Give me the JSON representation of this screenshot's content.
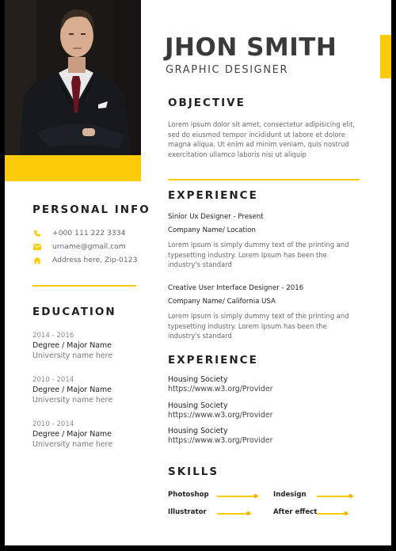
{
  "header": {
    "name": "JHON SMITH",
    "role": "GRAPHIC DESIGNER"
  },
  "colors": {
    "accent": "#fccc0b",
    "text": "#222222",
    "muted": "#6a6a6a"
  },
  "objective": {
    "heading": "OBJECTIVE",
    "lines": [
      "Lorem ipsum dolor sit amet, consectetur adipisicing elit,",
      "sed do eiusmod tempor incididunt ut labore et dolore",
      "magna aliqua. Ut enim ad minim veniam, quis nostrud",
      "exercitation ullamco laboris nisi ut aliquip"
    ]
  },
  "experience": {
    "heading": "EXPERIENCE",
    "items": [
      {
        "title": "Sinior Ux Designer - Present",
        "company": "Company Name/ Location",
        "lines": [
          "Lorem Ipsum is simply dummy text of the printing and",
          "typesetting industry. Lorem Ipsum has been the",
          "industry's standard"
        ]
      },
      {
        "title": "Creative User Interface Designer - 2016",
        "company": "Company Name/ California USA",
        "lines": [
          "Lorem Ipsum is simply dummy text of the printing and",
          "typesetting industry. Lorem Ipsum has been the",
          "industry's standard"
        ]
      }
    ]
  },
  "projects": {
    "heading": "EXPERIENCE",
    "items": [
      {
        "title": "Housing Society",
        "url": "https://www.w3.org/Provider"
      },
      {
        "title": "Housing Society",
        "url": "https://www.w3.org/Provider"
      },
      {
        "title": "Housing Society",
        "url": "https://www.w3.org/Provider"
      }
    ]
  },
  "skills": {
    "heading": "SKILLS",
    "items": [
      {
        "name": "Photoshop",
        "level": 0.9
      },
      {
        "name": "Indesign",
        "level": 0.8
      },
      {
        "name": "Illustrator",
        "level": 0.75
      },
      {
        "name": "After effect",
        "level": 0.7
      }
    ]
  },
  "personal_info": {
    "heading": "PERSONAL INFO",
    "phone": "+000 111 222 3334",
    "email": "urname@gmail.com",
    "address": "Address here, Zip-0123",
    "icons": [
      "phone-icon",
      "email-icon",
      "home-icon"
    ]
  },
  "education": {
    "heading": "EDUCATION",
    "items": [
      {
        "years": "2014 - 2016",
        "degree": "Degree / Major Name",
        "school": "University name here"
      },
      {
        "years": "2010 - 2014",
        "degree": "Degree / Major Name",
        "school": "University name here"
      },
      {
        "years": "2010 - 2014",
        "degree": "Degree / Major Name",
        "school": "University name here"
      }
    ]
  }
}
